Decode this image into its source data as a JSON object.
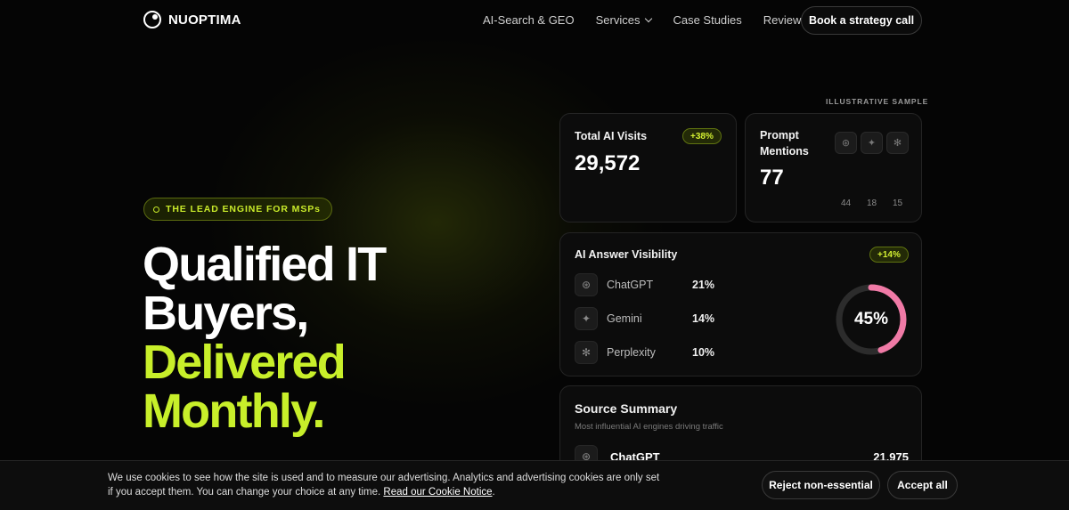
{
  "nav": {
    "logo_text": "NUOPTIMA",
    "links": [
      "AI-Search & GEO",
      "Services",
      "Case Studies",
      "Reviews"
    ],
    "cta_label": "Book a strategy call"
  },
  "hero": {
    "badge": "THE LEAD ENGINE FOR MSPs",
    "headline": [
      "Qualified IT",
      "Buyers,",
      "Delivered",
      "Monthly."
    ]
  },
  "dashboard": {
    "sample_label": "ILLUSTRATIVE SAMPLE",
    "total_visits": {
      "title": "Total AI Visits",
      "change": "+38%",
      "value": "29,572"
    },
    "prompt_mentions": {
      "title": "Prompt Mentions",
      "value": "77",
      "engines": [
        {
          "icon": "chatgpt-icon",
          "glyph": "⊛",
          "count": "44"
        },
        {
          "icon": "gemini-icon",
          "glyph": "✦",
          "count": "18"
        },
        {
          "icon": "perplexity-icon",
          "glyph": "✻",
          "count": "15"
        }
      ]
    },
    "visibility": {
      "title": "AI Answer Visibility",
      "change": "+14%",
      "rows": [
        {
          "name": "ChatGPT",
          "pct": "21%",
          "glyph": "⊛"
        },
        {
          "name": "Gemini",
          "pct": "14%",
          "glyph": "✦"
        },
        {
          "name": "Perplexity",
          "pct": "10%",
          "glyph": "✻"
        }
      ],
      "donut_label": "45%",
      "donut_fraction": 0.45,
      "colors": {
        "donut_fill": "#f07aa6",
        "donut_track": "#2c2c2c"
      }
    },
    "source_summary": {
      "title": "Source Summary",
      "subtitle": "Most influential AI engines driving traffic",
      "top_row": {
        "name": "ChatGPT",
        "value": "21,975",
        "glyph": "⊛"
      }
    }
  },
  "cookie": {
    "text": "We use cookies to see how the site is used and to measure our advertising. Analytics and advertising cookies are only set if you accept them. You can change your choice at any time.",
    "link": "Read our Cookie Notice",
    "reject_label": "Reject non-essential",
    "accept_label": "Accept all"
  },
  "colors": {
    "accent": "#c8ef2a",
    "background": "#050505"
  }
}
